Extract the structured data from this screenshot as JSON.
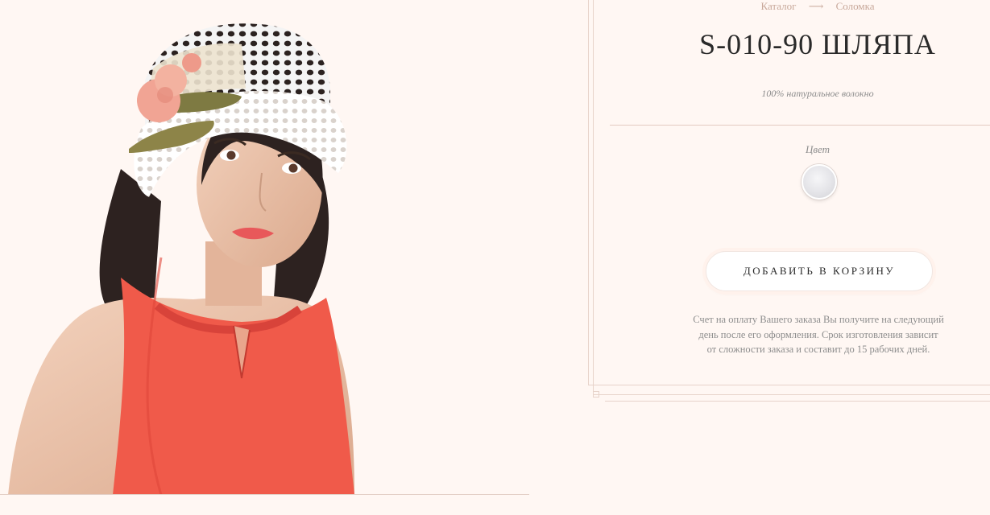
{
  "breadcrumb": {
    "items": [
      "Каталог",
      "Соломка"
    ],
    "separator": "⟶"
  },
  "product": {
    "title": "S-010-90 ШЛЯПА",
    "material": "100% натуральное волокно",
    "color_label": "Цвет",
    "swatch_color": "#e4e4e8",
    "add_to_cart": "ДОБАВИТЬ В КОРЗИНУ",
    "note_lines": [
      "Счет на оплату Вашего заказа Вы получите на следующий",
      "день после его оформления. Срок изготовления зависит",
      "от сложности заказа и составит до 15 рабочих дней."
    ]
  },
  "colors": {
    "background": "#fff7f3",
    "accent": "#c8a89a",
    "text": "#2a2a2a",
    "muted": "#8d8d8d",
    "dress": "#f05a4a"
  }
}
